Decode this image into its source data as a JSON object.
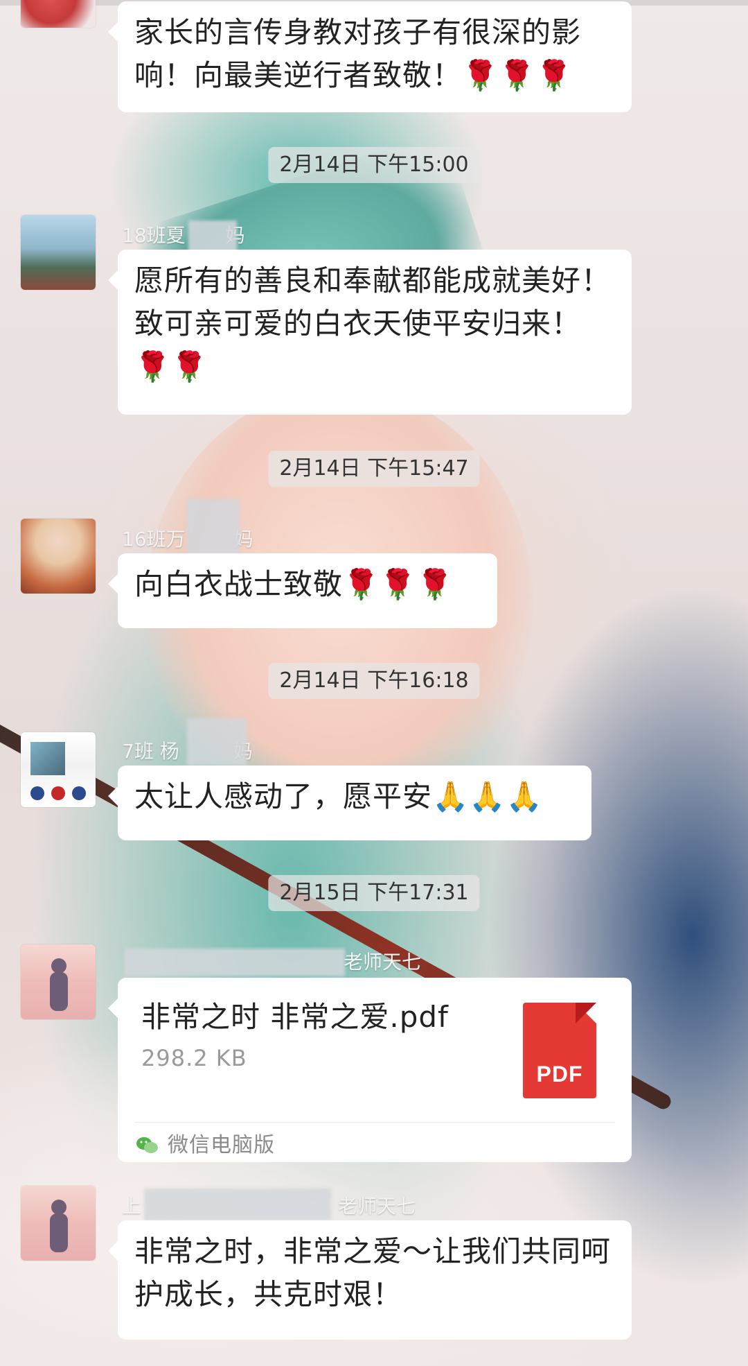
{
  "chat": {
    "messages": [
      {
        "sender": "",
        "text": "家长的言传身教对孩子有很深的影响！向最美逆行者致敬！",
        "emoji": "🌹🌹🌹"
      },
      {
        "time": "2月14日 下午15:00",
        "sender": "18班夏",
        "sender_suffix": "妈",
        "text": "愿所有的善良和奉献都能成就美好！致可亲可爱的白衣天使平安归来！",
        "emoji": "🌹🌹"
      },
      {
        "time": "2月14日 下午15:47",
        "sender": "16班万",
        "sender_suffix": "妈",
        "text": "向白衣战士致敬",
        "emoji": "🌹🌹🌹"
      },
      {
        "time": "2月14日 下午16:18",
        "sender": "7班 杨",
        "sender_suffix": "妈",
        "text": "太让人感动了，愿平安",
        "emoji": "🙏🙏🙏"
      },
      {
        "time": "2月15日 下午17:31",
        "sender": "",
        "sender_suffix": "老师天七",
        "file": {
          "name": "非常之时 非常之爱.pdf",
          "size": "298.2 KB",
          "type_label": "PDF",
          "source": "微信电脑版"
        }
      },
      {
        "sender": "上",
        "sender_suffix": "老师天七",
        "text": "非常之时，非常之爱～让我们共同呵护成长，共克时艰！"
      }
    ]
  },
  "colors": {
    "bubble": "#ffffff",
    "rose": "#c62828",
    "pdf_red": "#e53935",
    "timestamp_bg": "#e6e6e6"
  }
}
